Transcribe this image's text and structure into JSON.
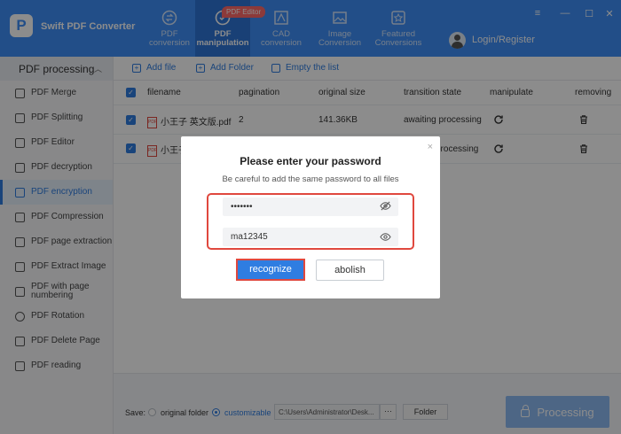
{
  "app": {
    "logo_letter": "P",
    "title": "Swift PDF Converter"
  },
  "nav": [
    {
      "label": "PDF\nconversion",
      "icon": "convert-icon"
    },
    {
      "label": "PDF\nmanipulation",
      "icon": "manipulation-icon",
      "active": true
    },
    {
      "label": "CAD\nconversion",
      "icon": "cad-icon"
    },
    {
      "label": "Image\nConversion",
      "icon": "image-icon"
    },
    {
      "label": "Featured\nConversions",
      "icon": "featured-icon"
    }
  ],
  "badge": "PDF Editor",
  "window": {
    "menu": "≡",
    "minimize": "—",
    "maximize": "☐",
    "close": "✕"
  },
  "user": {
    "login_label": "Login/Register"
  },
  "sidebar": {
    "header": "PDF processing",
    "items": [
      {
        "label": "PDF Merge"
      },
      {
        "label": "PDF Splitting"
      },
      {
        "label": "PDF Editor"
      },
      {
        "label": "PDF decryption"
      },
      {
        "label": "PDF encryption",
        "active": true
      },
      {
        "label": "PDF Compression"
      },
      {
        "label": "PDF page extraction"
      },
      {
        "label": "PDF Extract Image"
      },
      {
        "label": "PDF with page numbering"
      },
      {
        "label": "PDF Rotation"
      },
      {
        "label": "PDF Delete Page"
      },
      {
        "label": "PDF reading"
      }
    ]
  },
  "toolbar": {
    "add_file": "Add file",
    "add_folder": "Add Folder",
    "empty": "Empty the list"
  },
  "table": {
    "headers": {
      "filename": "filename",
      "pagination": "pagination",
      "size": "original size",
      "state": "transition state",
      "manipulate": "manipulate",
      "removing": "removing"
    },
    "rows": [
      {
        "filename": "小王子 英文版.pdf",
        "pagination": "2",
        "size": "141.36KB",
        "state": "awaiting processing"
      },
      {
        "filename": "小王子",
        "pagination": "",
        "size": "",
        "state": "processing"
      }
    ]
  },
  "footer": {
    "save_label": "Save:",
    "original_folder": "original folder",
    "customizable": "customizable",
    "path": "C:\\Users\\Administrator\\Desk...",
    "dots": "···",
    "folder_btn": "Folder",
    "process_btn": "Processing"
  },
  "dialog": {
    "close": "×",
    "title": "Please enter your password",
    "subtitle": "Be careful to add the same password to all files",
    "password_masked": "•••••••",
    "password_plain": "ma12345",
    "ok": "recognize",
    "cancel": "abolish"
  },
  "colors": {
    "header": "#3f8ff7",
    "accent": "#2f7de1",
    "highlight": "#e0483e"
  }
}
